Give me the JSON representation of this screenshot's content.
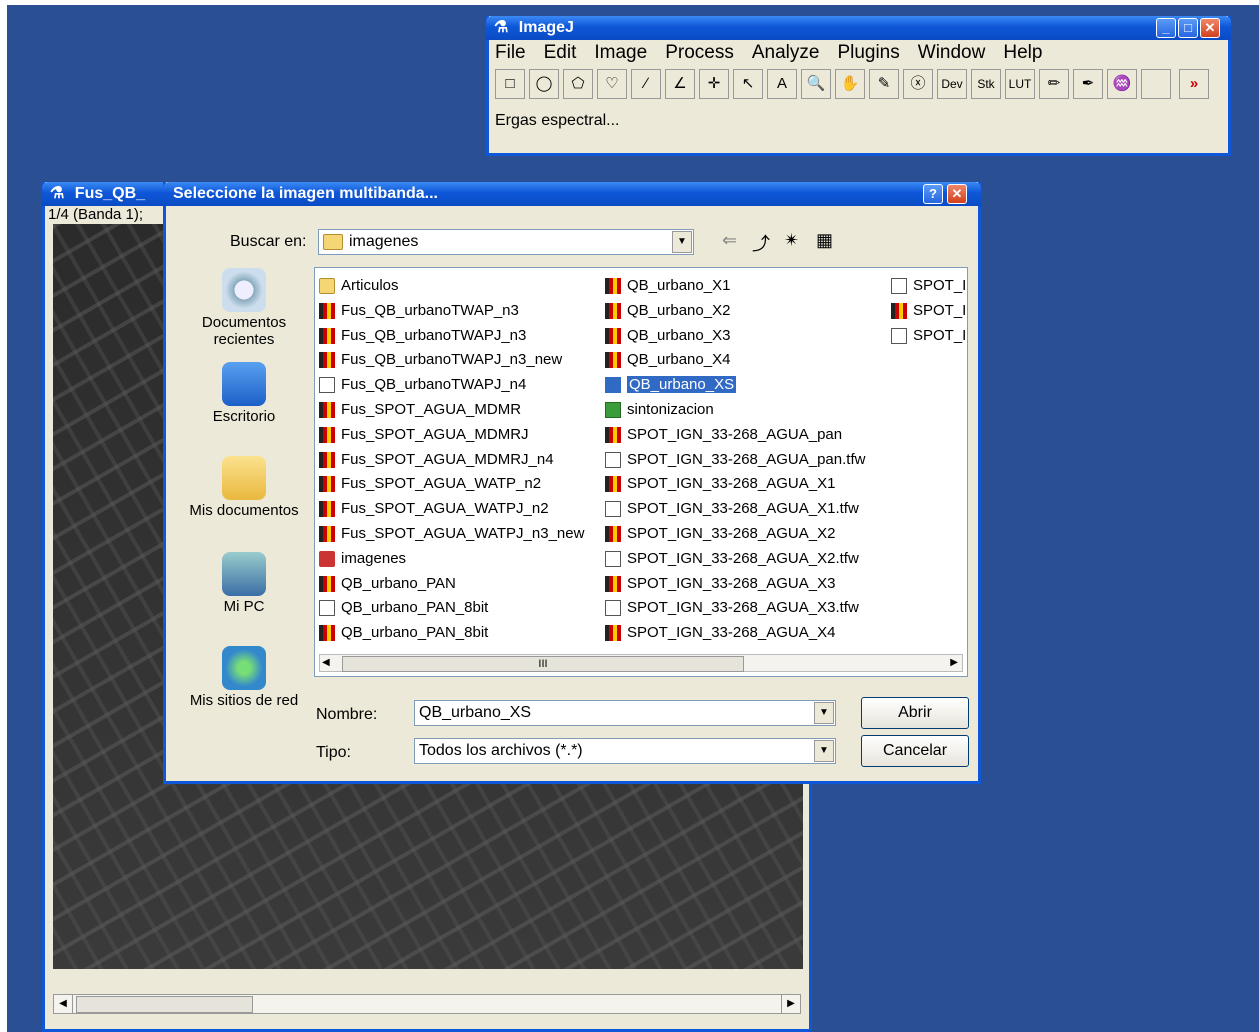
{
  "imagej": {
    "title": "ImageJ",
    "menu": [
      "File",
      "Edit",
      "Image",
      "Process",
      "Analyze",
      "Plugins",
      "Window",
      "Help"
    ],
    "tools": [
      "□",
      "◯",
      "⬠",
      "♡",
      "∕",
      "∠",
      "✛",
      "↖",
      "A",
      "🔍",
      "✋",
      "✎",
      "ⓧ",
      "Dev",
      "Stk",
      "LUT",
      "✏",
      "✒",
      "♒",
      " ",
      "»"
    ],
    "status": "Ergas espectral..."
  },
  "imgwin": {
    "title": "Fus_QB_",
    "subtitle": "1/4 (Banda 1);"
  },
  "dialog": {
    "title": "Seleccione la imagen multibanda...",
    "lookin_label": "Buscar en:",
    "lookin_value": "imagenes",
    "places": [
      "Documentos recientes",
      "Escritorio",
      "Mis documentos",
      "Mi PC",
      "Mis sitios de red"
    ],
    "col1": [
      {
        "name": "Articulos",
        "icon": "fold"
      },
      {
        "name": "Fus_QB_urbanoTWAP_n3",
        "icon": "tif"
      },
      {
        "name": "Fus_QB_urbanoTWAPJ_n3",
        "icon": "tif"
      },
      {
        "name": "Fus_QB_urbanoTWAPJ_n3_new",
        "icon": "tif"
      },
      {
        "name": "Fus_QB_urbanoTWAPJ_n4",
        "icon": "dat"
      },
      {
        "name": "Fus_SPOT_AGUA_MDMR",
        "icon": "tif"
      },
      {
        "name": "Fus_SPOT_AGUA_MDMRJ",
        "icon": "tif"
      },
      {
        "name": "Fus_SPOT_AGUA_MDMRJ_n4",
        "icon": "tif"
      },
      {
        "name": "Fus_SPOT_AGUA_WATP_n2",
        "icon": "tif"
      },
      {
        "name": "Fus_SPOT_AGUA_WATPJ_n2",
        "icon": "tif"
      },
      {
        "name": "Fus_SPOT_AGUA_WATPJ_n3_new",
        "icon": "tif"
      },
      {
        "name": "imagenes",
        "icon": "bad"
      },
      {
        "name": "QB_urbano_PAN",
        "icon": "tif"
      },
      {
        "name": "QB_urbano_PAN_8bit",
        "icon": "dat"
      },
      {
        "name": "QB_urbano_PAN_8bit",
        "icon": "tif"
      }
    ],
    "col2": [
      {
        "name": "QB_urbano_X1",
        "icon": "tif"
      },
      {
        "name": "QB_urbano_X2",
        "icon": "tif"
      },
      {
        "name": "QB_urbano_X3",
        "icon": "tif"
      },
      {
        "name": "QB_urbano_X4",
        "icon": "tif"
      },
      {
        "name": "QB_urbano_XS",
        "icon": "sel",
        "selected": true
      },
      {
        "name": "sintonizacion",
        "icon": "xls"
      },
      {
        "name": "SPOT_IGN_33-268_AGUA_pan",
        "icon": "tif"
      },
      {
        "name": "SPOT_IGN_33-268_AGUA_pan.tfw",
        "icon": "dat"
      },
      {
        "name": "SPOT_IGN_33-268_AGUA_X1",
        "icon": "tif"
      },
      {
        "name": "SPOT_IGN_33-268_AGUA_X1.tfw",
        "icon": "dat"
      },
      {
        "name": "SPOT_IGN_33-268_AGUA_X2",
        "icon": "tif"
      },
      {
        "name": "SPOT_IGN_33-268_AGUA_X2.tfw",
        "icon": "dat"
      },
      {
        "name": "SPOT_IGN_33-268_AGUA_X3",
        "icon": "tif"
      },
      {
        "name": "SPOT_IGN_33-268_AGUA_X3.tfw",
        "icon": "dat"
      },
      {
        "name": "SPOT_IGN_33-268_AGUA_X4",
        "icon": "tif"
      }
    ],
    "col3": [
      {
        "name": "SPOT_I",
        "icon": "dat"
      },
      {
        "name": "SPOT_I",
        "icon": "tif"
      },
      {
        "name": "SPOT_I",
        "icon": "dat"
      }
    ],
    "scroll_grip": "III",
    "name_label": "Nombre:",
    "name_value": "QB_urbano_XS",
    "type_label": "Tipo:",
    "type_value": "Todos los archivos (*.*)",
    "open": "Abrir",
    "cancel": "Cancelar"
  }
}
